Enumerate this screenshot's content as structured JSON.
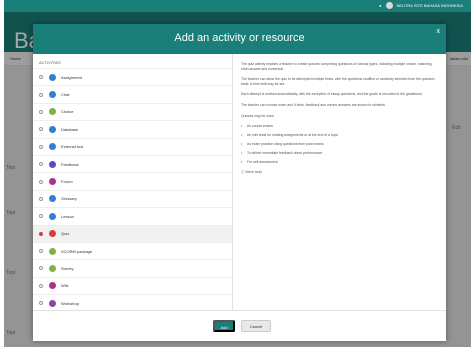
{
  "background": {
    "site_title": "Bat",
    "user_name": "NEUTRA SITE BAHASA INDONESIA",
    "nav_left": "Home",
    "nav_right": "dalam situ",
    "side_labels": [
      "Topi",
      "Topi",
      "Topi",
      "Topi"
    ],
    "side_right": "Edit"
  },
  "modal": {
    "title": "Add an activity or resource",
    "close_label": "x",
    "activities_heading": "ACTIVITIES",
    "activities": [
      {
        "label": "Assignment",
        "color": "#2f7fd6",
        "selected": false
      },
      {
        "label": "Chat",
        "color": "#2f7fd6",
        "selected": false
      },
      {
        "label": "Choice",
        "color": "#7cb342",
        "selected": false
      },
      {
        "label": "Database",
        "color": "#2f7fd6",
        "selected": false
      },
      {
        "label": "External tool",
        "color": "#2f7fd6",
        "selected": false
      },
      {
        "label": "Feedback",
        "color": "#5c4bb8",
        "selected": false
      },
      {
        "label": "Forum",
        "color": "#b0308a",
        "selected": false
      },
      {
        "label": "Glossary",
        "color": "#2f7fd6",
        "selected": false
      },
      {
        "label": "Lesson",
        "color": "#2f7fd6",
        "selected": false
      },
      {
        "label": "Quiz",
        "color": "#d43f3a",
        "selected": true
      },
      {
        "label": "SCORM package",
        "color": "#7cb342",
        "selected": false
      },
      {
        "label": "Survey",
        "color": "#7cb342",
        "selected": false
      },
      {
        "label": "Wiki",
        "color": "#b0308a",
        "selected": false
      },
      {
        "label": "Workshop",
        "color": "#8e44ad",
        "selected": false
      }
    ],
    "description": {
      "paragraphs": [
        "The quiz activity enables a teacher to create quizzes comprising questions of various types, including multiple choice, matching, short-answer and numerical.",
        "The teacher can allow the quiz to be attempted multiple times, with the questions shuffled or randomly selected from the question bank. A time limit may be set.",
        "Each attempt is marked automatically, with the exception of essay questions, and the grade is recorded in the gradebook.",
        "The teacher can choose when and if hints, feedback and correct answers are shown to students.",
        "Quizzes may be used"
      ],
      "uses": [
        "As course exams",
        "As mini tests for reading assignments or at the end of a topic",
        "As exam practice using questions from past exams",
        "To deliver immediate feedback about performance",
        "For self-assessment"
      ],
      "help_link": "More help"
    },
    "footer": {
      "add_label": "Add",
      "cancel_label": "Cancel"
    }
  }
}
